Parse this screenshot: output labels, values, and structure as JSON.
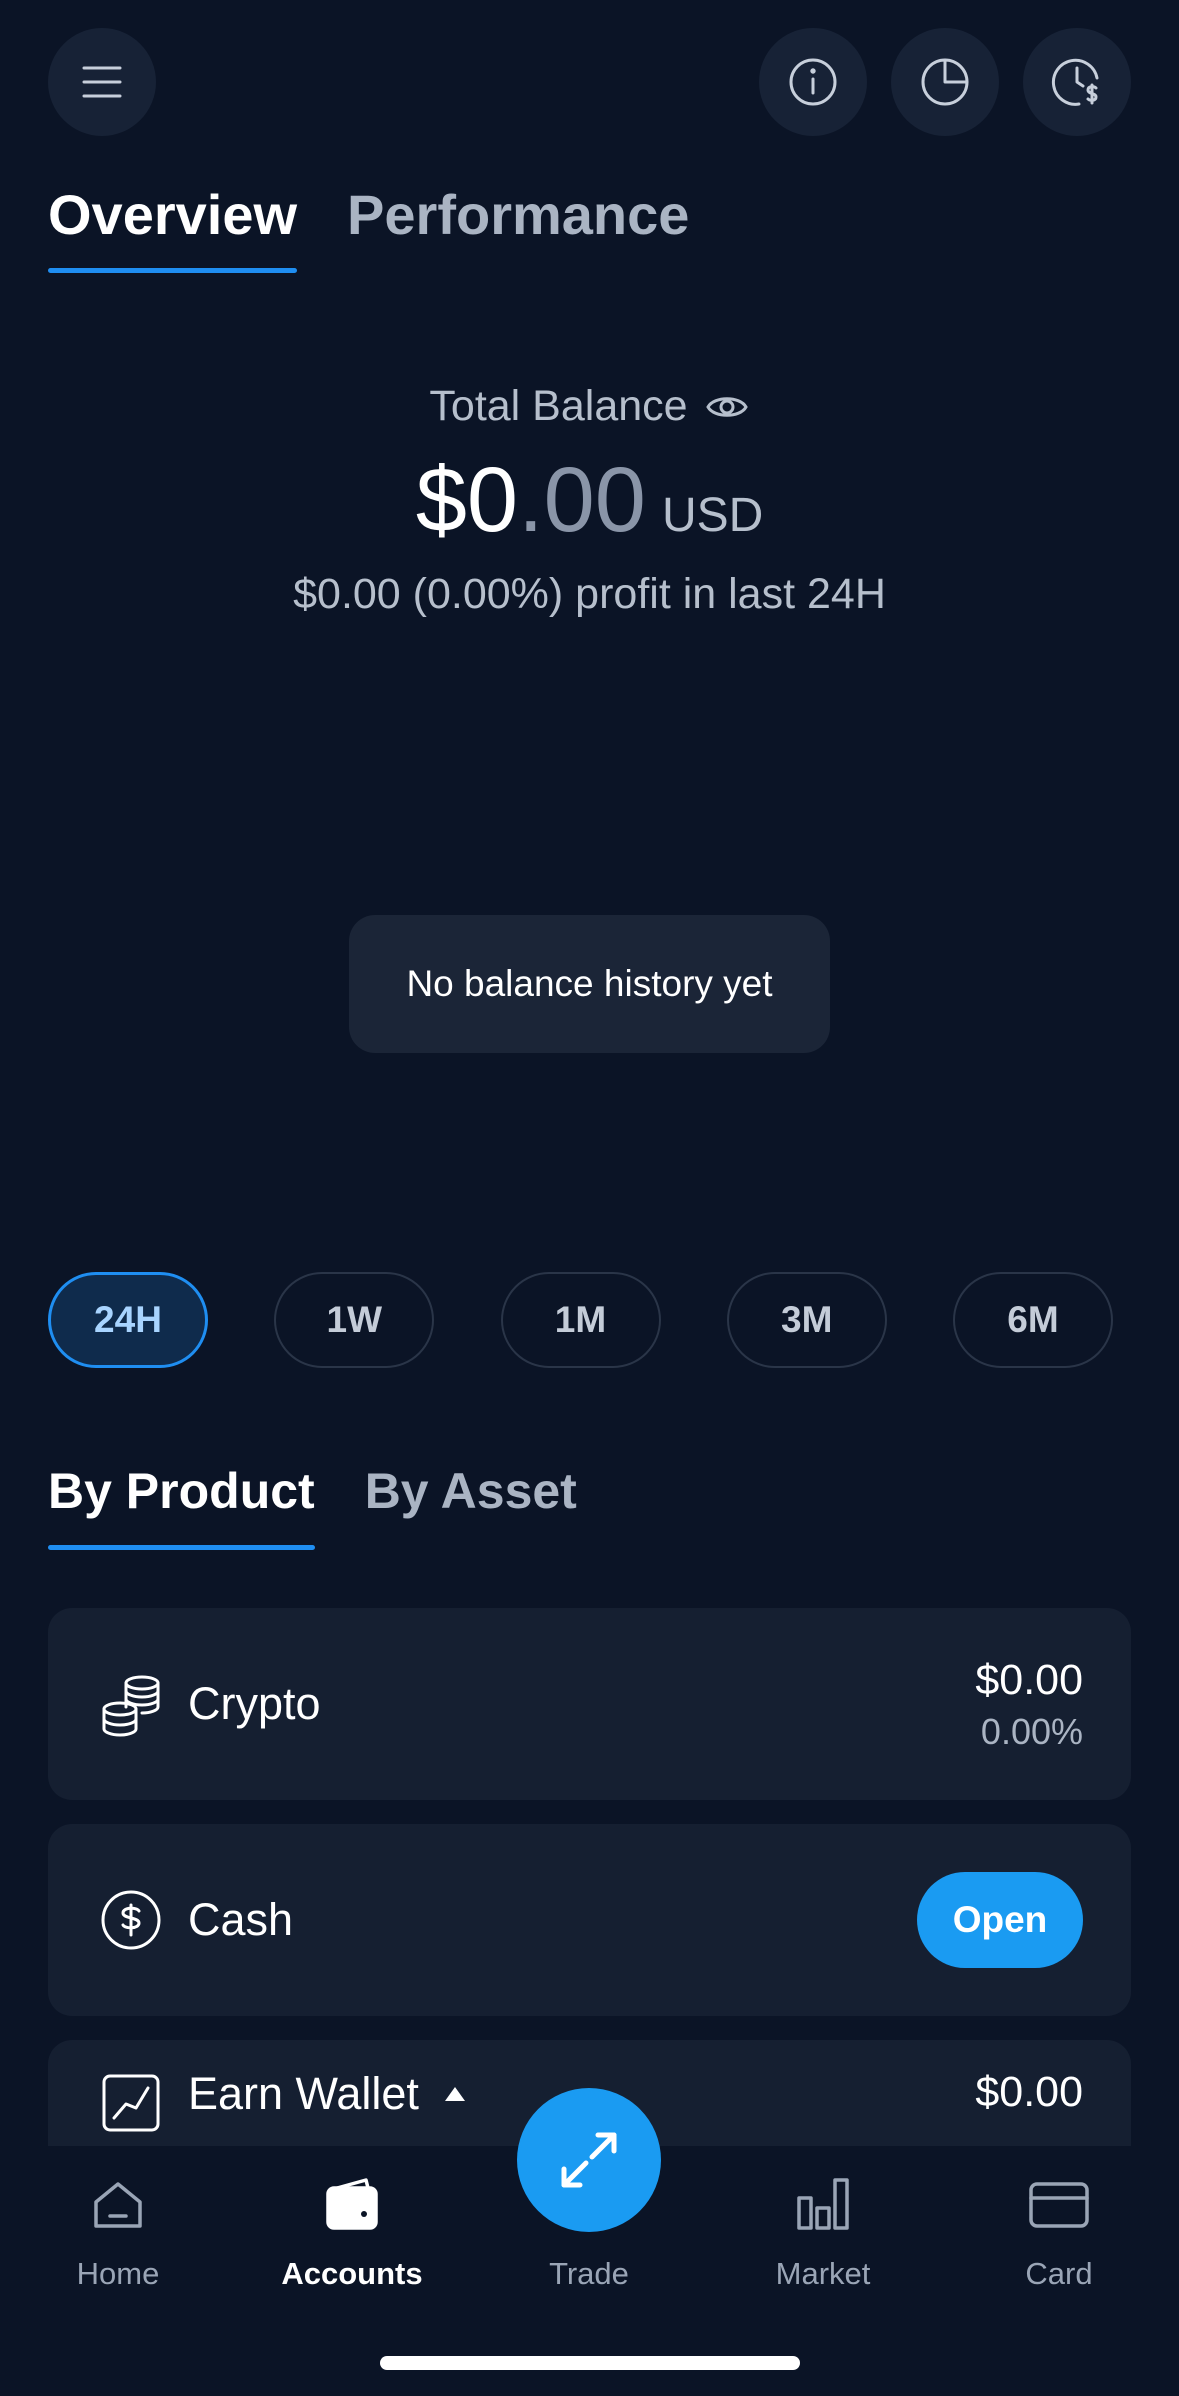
{
  "header": {
    "menu_icon": "hamburger-icon",
    "actions": [
      "info-icon",
      "pie-chart-icon",
      "clock-dollar-icon"
    ]
  },
  "tabs": [
    {
      "label": "Overview",
      "active": true
    },
    {
      "label": "Performance",
      "active": false
    }
  ],
  "balance": {
    "label": "Total Balance",
    "amount_int": "$0",
    "amount_dec": ".00",
    "currency": "USD",
    "profit_text": "$0.00 (0.00%) profit in last 24H"
  },
  "chart": {
    "empty_text": "No balance history yet"
  },
  "periods": [
    {
      "label": "24H",
      "active": true
    },
    {
      "label": "1W",
      "active": false
    },
    {
      "label": "1M",
      "active": false
    },
    {
      "label": "3M",
      "active": false
    },
    {
      "label": "6M",
      "active": false
    }
  ],
  "sub_tabs": [
    {
      "label": "By Product",
      "active": true
    },
    {
      "label": "By Asset",
      "active": false
    }
  ],
  "products": {
    "crypto": {
      "label": "Crypto",
      "amount": "$0.00",
      "percent": "0.00%"
    },
    "cash": {
      "label": "Cash",
      "action": "Open"
    },
    "earn": {
      "label": "Earn Wallet",
      "amount": "$0.00"
    }
  },
  "nav": {
    "home": "Home",
    "accounts": "Accounts",
    "trade": "Trade",
    "market": "Market",
    "card": "Card"
  },
  "colors": {
    "background": "#0b1426",
    "accent": "#1a9bf2",
    "card": "#151f31"
  }
}
